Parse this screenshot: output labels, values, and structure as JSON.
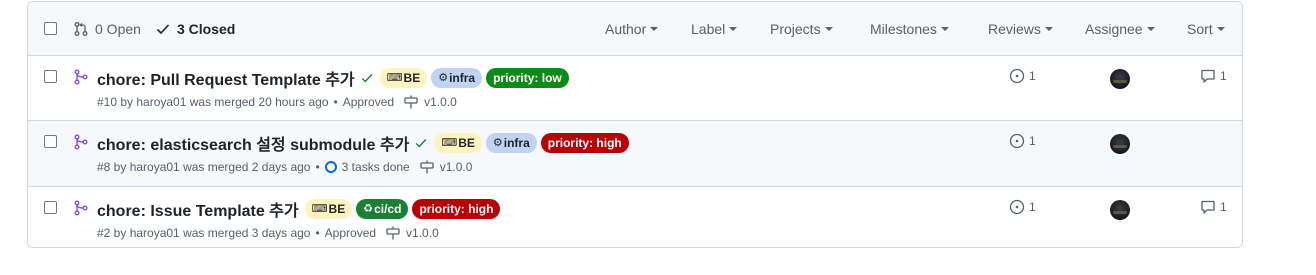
{
  "header": {
    "open_label": "0 Open",
    "closed_label": "3 Closed",
    "filters": {
      "author": "Author",
      "label": "Label",
      "projects": "Projects",
      "milestones": "Milestones",
      "reviews": "Reviews",
      "assignee": "Assignee",
      "sort": "Sort"
    }
  },
  "colors": {
    "merged_icon": "#8250df",
    "check": "#1a7f37",
    "label_be": "#fff3bf",
    "label_infra": "#bfd4f2",
    "label_cicd": "#1a7f37",
    "priority_low": "#0e8a16",
    "priority_high": "#b60205",
    "task_ring": "#0969da"
  },
  "rows": [
    {
      "title": "chore: Pull Request Template 추가",
      "labels": [
        {
          "text": "BE",
          "emoji": "⌨",
          "kind": "be"
        },
        {
          "text": "infra",
          "emoji": "⚙",
          "kind": "infra"
        },
        {
          "text": "priority: low",
          "kind": "priority-low"
        }
      ],
      "meta": "#10 by haroya01 was merged 20 hours ago",
      "status": "Approved",
      "milestone": "v1.0.0",
      "linked_issues": "1",
      "comments": "1"
    },
    {
      "title": "chore: elasticsearch 설정 submodule 추가",
      "labels": [
        {
          "text": "BE",
          "emoji": "⌨",
          "kind": "be"
        },
        {
          "text": "infra",
          "emoji": "⚙",
          "kind": "infra"
        },
        {
          "text": "priority: high",
          "kind": "priority-high"
        }
      ],
      "meta": "#8 by haroya01 was merged 2 days ago",
      "status": "3 tasks done",
      "milestone": "v1.0.0",
      "linked_issues": "1",
      "comments": ""
    },
    {
      "title": "chore: Issue Template 추가",
      "labels": [
        {
          "text": "BE",
          "emoji": "⌨",
          "kind": "be"
        },
        {
          "text": "ci/cd",
          "emoji": "♻",
          "kind": "cicd"
        },
        {
          "text": "priority: high",
          "kind": "priority-high"
        }
      ],
      "meta": "#2 by haroya01 was merged 3 days ago",
      "status": "Approved",
      "milestone": "v1.0.0",
      "linked_issues": "1",
      "comments": "1"
    }
  ]
}
